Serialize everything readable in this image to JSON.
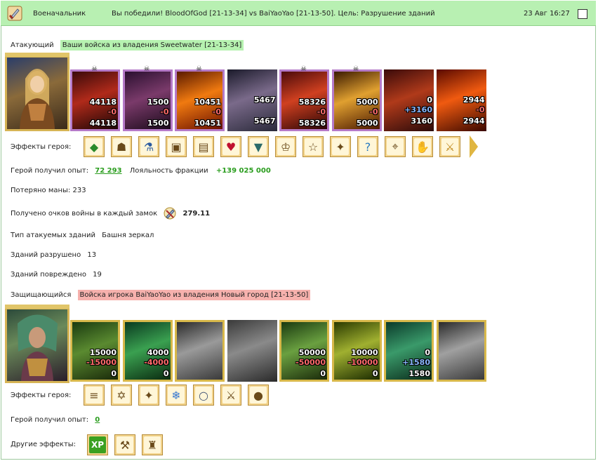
{
  "topbar": {
    "role": "Военачальник",
    "message": "Вы победили! BloodOfGod [21-13-34] vs BaiYaoYao [21-13-50]. Цель: Разрушение зданий",
    "time": "23 Авг 16:27"
  },
  "attacker": {
    "label": "Атакующий",
    "tag": "Ваши войска из владения Sweetwater [21-13-34]",
    "units": [
      {
        "a": "44118",
        "b": "-0",
        "c": "44118",
        "frame": "purple",
        "skull": true,
        "theme": "red-dragon"
      },
      {
        "a": "1500",
        "b": "-0",
        "c": "1500",
        "frame": "purple",
        "skull": true,
        "theme": "skeleton"
      },
      {
        "a": "10451",
        "b": "-0",
        "c": "10451",
        "frame": "purple",
        "skull": true,
        "theme": "fire"
      },
      {
        "a": "5467",
        "b": "",
        "c": "5467",
        "frame": "none",
        "skull": false,
        "theme": "gargoyle"
      },
      {
        "a": "58326",
        "b": "-0",
        "c": "58326",
        "frame": "purple",
        "skull": true,
        "theme": "red-dragon2"
      },
      {
        "a": "5000",
        "b": "-0",
        "c": "5000",
        "frame": "purple",
        "skull": true,
        "theme": "fire2"
      },
      {
        "a": "0",
        "b": "+3160",
        "c": "3160",
        "frame": "none",
        "skull": false,
        "theme": "demoness",
        "blue": true
      },
      {
        "a": "2944",
        "b": "-0",
        "c": "2944",
        "frame": "none",
        "skull": false,
        "theme": "fire3"
      }
    ],
    "effects_label": "Эффекты героя:",
    "effects": [
      "gem-icon",
      "armor-icon",
      "potion-icon",
      "chest-icon",
      "chest2-icon",
      "heart-icon",
      "shield-icon",
      "hero-icon",
      "pentagram-icon",
      "crest-icon",
      "question-icon",
      "map-icon",
      "gauntlet-icon",
      "sword-icon"
    ],
    "exp_label": "Герой получил опыт:",
    "exp_value": "72 293",
    "loyalty_label": "Лояльность фракции",
    "loyalty_value": "+139 025 000",
    "mana_label": "Потеряно маны:",
    "mana_value": "233",
    "warpoints_label": "Получено очков войны в каждый замок",
    "warpoints_value": "279.11",
    "building_type_label": "Тип атакуемых зданий",
    "building_type_value": "Башня зеркал",
    "destroyed_label": "Зданий разрушено",
    "destroyed_value": "13",
    "damaged_label": "Зданий повреждено",
    "damaged_value": "19"
  },
  "defender": {
    "label": "Защищающийся",
    "tag": "Войска игрока BaiYaoYao из владения Новый город [21-13-50]",
    "units": [
      {
        "a": "15000",
        "b": "-15000",
        "c": "0",
        "frame": "gold",
        "theme": "dwarf"
      },
      {
        "a": "4000",
        "b": "-4000",
        "c": "0",
        "frame": "gold",
        "theme": "elf"
      },
      {
        "a": "",
        "b": "",
        "c": "",
        "frame": "gold",
        "theme": "knight-gray"
      },
      {
        "a": "",
        "b": "",
        "c": "",
        "frame": "none",
        "theme": "griffin-gray"
      },
      {
        "a": "50000",
        "b": "-50000",
        "c": "0",
        "frame": "gold",
        "theme": "archer"
      },
      {
        "a": "10000",
        "b": "-10000",
        "c": "0",
        "frame": "gold",
        "theme": "druid"
      },
      {
        "a": "0",
        "b": "+1580",
        "c": "1580",
        "frame": "gold",
        "theme": "ranger",
        "blue": true
      },
      {
        "a": "",
        "b": "",
        "c": "",
        "frame": "gold",
        "theme": "sage-gray"
      }
    ],
    "effects_label": "Эффекты героя:",
    "effects": [
      "scroll-icon",
      "rune-icon",
      "wand-icon",
      "crystal-icon",
      "ring-icon",
      "blade-icon",
      "orb-icon"
    ],
    "exp_label": "Герой получил опыт:",
    "exp_value": "0",
    "other_label": "Другие эффекты:",
    "other_effects": [
      "xp-icon",
      "hammer-icon",
      "tower-icon"
    ],
    "xp_text": "XP"
  },
  "colors": {
    "topbar": "#b8f0b2",
    "attacker_tag": "#b6f2b0",
    "defender_tag": "#f6b1ad",
    "gold_frame": "#d8b84a",
    "purple_frame": "#b57ac8"
  }
}
